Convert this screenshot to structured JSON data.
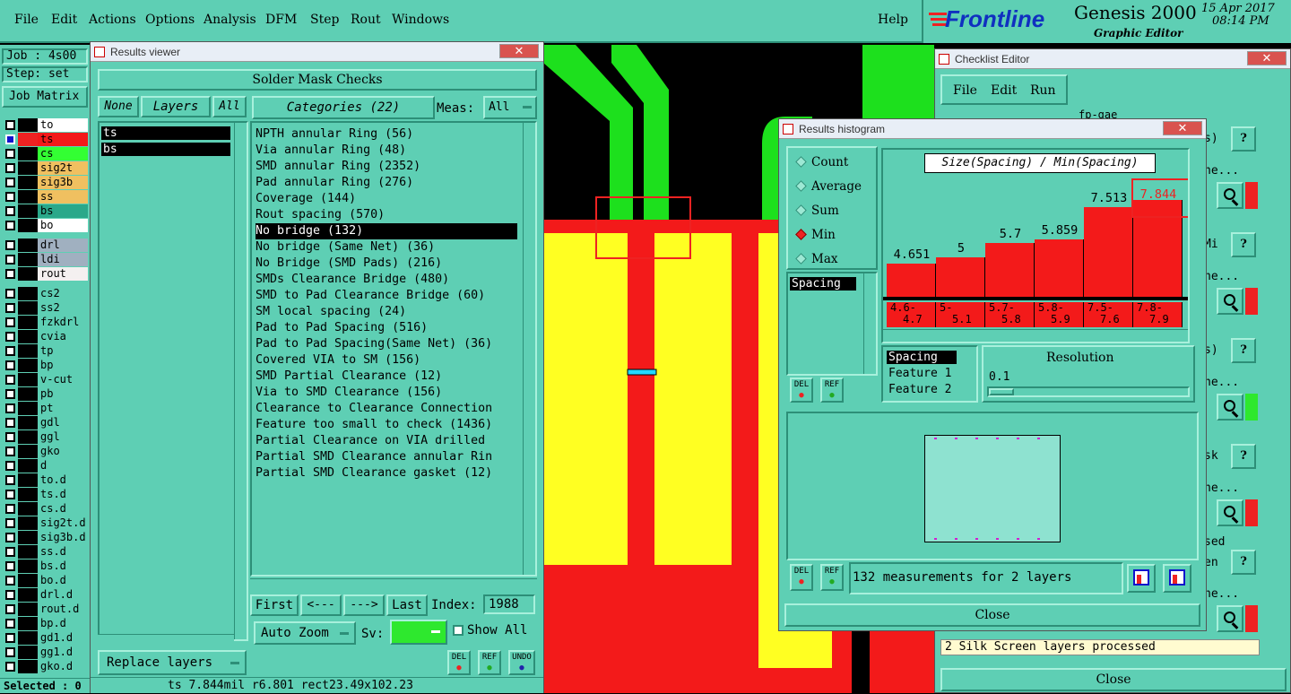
{
  "menu": {
    "items": [
      "File",
      "Edit",
      "Actions",
      "Options",
      "Analysis",
      "DFM",
      "Step",
      "Rout",
      "Windows"
    ],
    "help": "Help"
  },
  "brand": {
    "logo": "Frontline",
    "product": "Genesis 2000",
    "subtitle": "Graphic Editor",
    "date": "15 Apr 2017",
    "time": "08:14 PM"
  },
  "job": {
    "job_label": "Job : 4s00",
    "step_label": "Step: set",
    "matrix_button": "Job Matrix",
    "selected": "Selected : 0"
  },
  "layers": [
    {
      "name": "to",
      "color": "#ffffff",
      "state": "empty"
    },
    {
      "name": "ts",
      "color": "#f31a1a",
      "state": "active"
    },
    {
      "name": "cs",
      "color": "#33ff33",
      "state": "empty"
    },
    {
      "name": "sig2t",
      "color": "#f0c060",
      "state": "empty"
    },
    {
      "name": "sig3b",
      "color": "#f0c060",
      "state": "empty"
    },
    {
      "name": "ss",
      "color": "#f0c060",
      "state": "empty"
    },
    {
      "name": "bs",
      "color": "#2aa88a",
      "state": "empty"
    },
    {
      "name": "bo",
      "color": "#ffffff",
      "state": "empty"
    },
    {
      "name": "drl",
      "color": "#a0b0c0",
      "state": "empty"
    },
    {
      "name": "ldi",
      "color": "#a0b0c0",
      "state": "empty"
    },
    {
      "name": "rout",
      "color": "#f4f0f0",
      "state": "empty"
    },
    {
      "name": "cs2",
      "color": "#5ecfb4",
      "state": "empty"
    },
    {
      "name": "ss2",
      "color": "#5ecfb4",
      "state": "empty"
    },
    {
      "name": "fzkdrl",
      "color": "#5ecfb4",
      "state": "empty"
    },
    {
      "name": "cvia",
      "color": "#5ecfb4",
      "state": "empty"
    },
    {
      "name": "tp",
      "color": "#5ecfb4",
      "state": "empty"
    },
    {
      "name": "bp",
      "color": "#5ecfb4",
      "state": "empty"
    },
    {
      "name": "v-cut",
      "color": "#5ecfb4",
      "state": "empty"
    },
    {
      "name": "pb",
      "color": "#5ecfb4",
      "state": "empty"
    },
    {
      "name": "pt",
      "color": "#5ecfb4",
      "state": "empty"
    },
    {
      "name": "gdl",
      "color": "#5ecfb4",
      "state": "empty"
    },
    {
      "name": "ggl",
      "color": "#5ecfb4",
      "state": "empty"
    },
    {
      "name": "gko",
      "color": "#5ecfb4",
      "state": "empty"
    },
    {
      "name": "d",
      "color": "#5ecfb4",
      "state": "empty"
    },
    {
      "name": "to.d",
      "color": "#5ecfb4",
      "state": "empty"
    },
    {
      "name": "ts.d",
      "color": "#5ecfb4",
      "state": "empty"
    },
    {
      "name": "cs.d",
      "color": "#5ecfb4",
      "state": "empty"
    },
    {
      "name": "sig2t.d",
      "color": "#5ecfb4",
      "state": "empty"
    },
    {
      "name": "sig3b.d",
      "color": "#5ecfb4",
      "state": "empty"
    },
    {
      "name": "ss.d",
      "color": "#5ecfb4",
      "state": "empty"
    },
    {
      "name": "bs.d",
      "color": "#5ecfb4",
      "state": "empty"
    },
    {
      "name": "bo.d",
      "color": "#5ecfb4",
      "state": "empty"
    },
    {
      "name": "drl.d",
      "color": "#5ecfb4",
      "state": "empty"
    },
    {
      "name": "rout.d",
      "color": "#5ecfb4",
      "state": "empty"
    },
    {
      "name": "bp.d",
      "color": "#5ecfb4",
      "state": "empty"
    },
    {
      "name": "gd1.d",
      "color": "#5ecfb4",
      "state": "empty"
    },
    {
      "name": "gg1.d",
      "color": "#5ecfb4",
      "state": "empty"
    },
    {
      "name": "gko.d",
      "color": "#5ecfb4",
      "state": "empty"
    }
  ],
  "results_viewer": {
    "title": "Results viewer",
    "heading": "Solder Mask Checks",
    "none_btn": "None",
    "layers_btn": "Layers",
    "all_btn": "All",
    "categories_btn": "Categories (22)",
    "meas_label": "Meas:",
    "meas_value": "All",
    "layer_list": [
      "ts",
      "bs"
    ],
    "categories": [
      "NPTH annular Ring (56)",
      "Via annular Ring (48)",
      "SMD annular Ring (2352)",
      "Pad annular Ring (276)",
      "Coverage (144)",
      "Rout spacing (570)",
      "No bridge (132)",
      "No bridge (Same Net) (36)",
      "No Bridge (SMD Pads) (216)",
      "SMDs Clearance Bridge (480)",
      "SMD to Pad Clearance Bridge (60)",
      "SM local spacing (24)",
      "Pad to Pad Spacing (516)",
      "Pad to Pad Spacing(Same Net) (36)",
      "Covered VIA to SM (156)",
      "SMD Partial Clearance (12)",
      "Via to SMD Clearance (156)",
      "Clearance to Clearance Connection",
      "Feature too small to check (1436)",
      "Partial Clearance on VIA drilled",
      "Partial SMD Clearance annular Rin",
      "Partial SMD Clearance gasket (12)"
    ],
    "selected_index": 6,
    "first_btn": "First",
    "prev_btn": "<---",
    "next_btn": "--->",
    "last_btn": "Last",
    "index_label": "Index:",
    "index_value": "1988",
    "auto_zoom": "Auto Zoom",
    "sv_label": "Sv:",
    "show_all": "Show All",
    "replace_layers": "Replace layers",
    "del": "DEL",
    "ref": "REF",
    "undo": "UNDO",
    "status": "ts 7.844mil   r6.801   rect23.49x102.23"
  },
  "histogram": {
    "title": "Results histogram",
    "modes": [
      {
        "label": "Count",
        "on": false
      },
      {
        "label": "Average",
        "on": false
      },
      {
        "label": "Sum",
        "on": false
      },
      {
        "label": "Min",
        "on": true
      },
      {
        "label": "Max",
        "on": false
      }
    ],
    "meas_list": [
      "Spacing"
    ],
    "chart_title": "Size(Spacing) / Min(Spacing)",
    "resolution_label": "Resolution",
    "resolution_value": "0.1",
    "fields": [
      "Spacing",
      "Feature 1",
      "Feature 2"
    ],
    "summary": "132 measurements for 2 layers",
    "close": "Close",
    "del": "DEL",
    "ref": "REF"
  },
  "chart_data": {
    "type": "bar",
    "title": "Size(Spacing) / Min(Spacing)",
    "categories": [
      "4.6-4.7",
      "5-5.1",
      "5.7-5.8",
      "5.8-5.9",
      "7.5-7.6",
      "7.8-7.9"
    ],
    "category_lines": [
      [
        "4.6-",
        "4.7"
      ],
      [
        "5-",
        "5.1"
      ],
      [
        "5.7-",
        "5.8"
      ],
      [
        "5.8-",
        "5.9"
      ],
      [
        "7.5-",
        "7.6"
      ],
      [
        "7.8-",
        "7.9"
      ]
    ],
    "values": [
      4.651,
      5,
      5.7,
      5.859,
      7.513,
      7.844
    ],
    "value_labels": [
      "4.651",
      "5",
      "5.7",
      "5.859",
      "7.513",
      "7.844"
    ],
    "highlighted_index": 5,
    "ylim": [
      3.0,
      8.4
    ],
    "bar_color": "#f31a1a"
  },
  "checklist": {
    "title": "Checklist Editor",
    "menu": [
      "File",
      "Edit",
      "Run"
    ],
    "name": "fp-gae",
    "row_labels": [
      "s)",
      "ne...",
      "Mi",
      "ne...",
      "s)",
      "ne...",
      "sk",
      "ne...",
      "sed",
      "en",
      "ne..."
    ],
    "status": "2 Silk Screen layers processed",
    "close": "Close",
    "help": "?"
  }
}
